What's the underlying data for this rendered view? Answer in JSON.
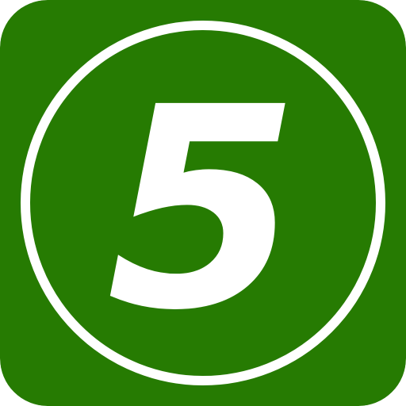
{
  "icon": {
    "name": "number-5-icon",
    "numeral": "5",
    "colors": {
      "background": "#267b02",
      "ring": "#ffffff",
      "numeral": "#ffffff"
    }
  }
}
